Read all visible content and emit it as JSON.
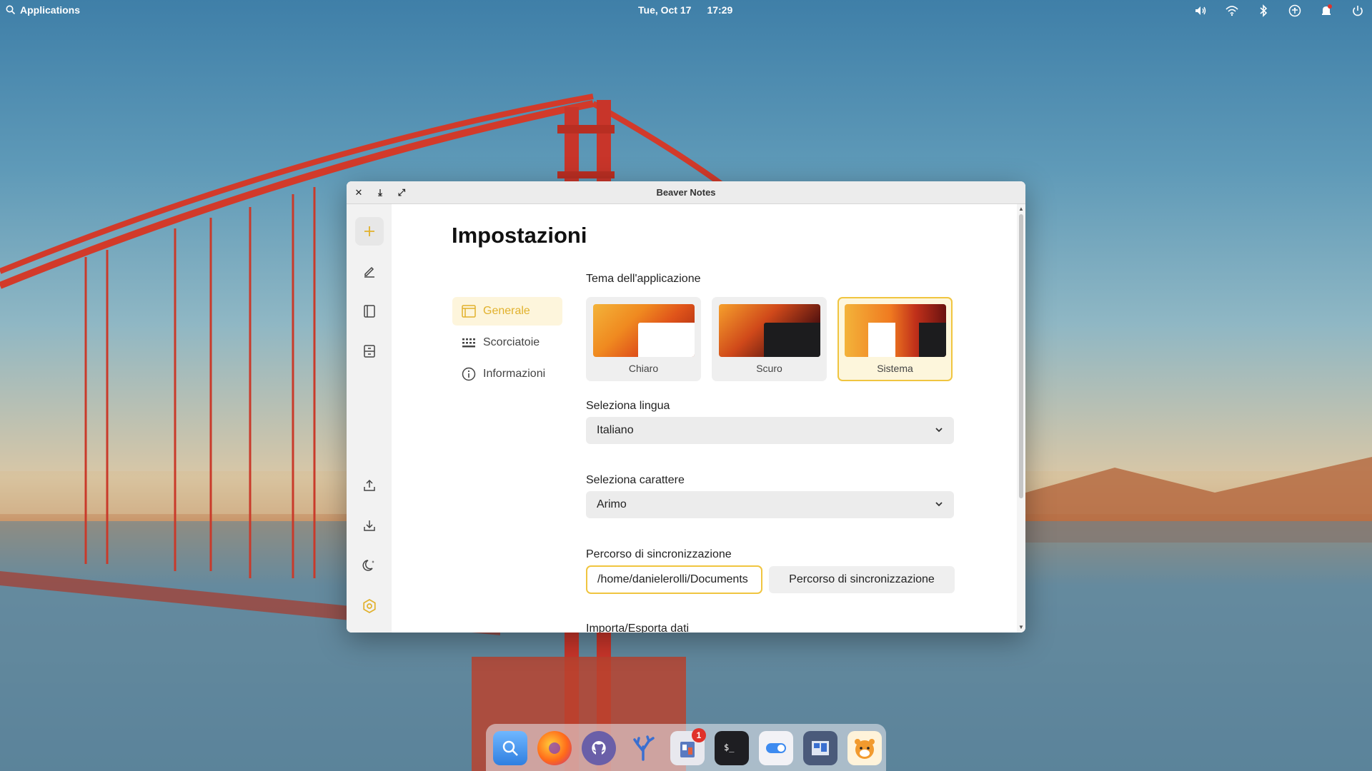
{
  "topbar": {
    "applications_label": "Applications",
    "date": "Tue, Oct 17",
    "time": "17:29",
    "tray_icons": [
      "volume-icon",
      "wifi-icon",
      "bluetooth-icon",
      "accessibility-icon",
      "notification-icon",
      "power-icon"
    ]
  },
  "window": {
    "title": "Beaver Notes",
    "controls": [
      "close-icon",
      "minimize-icon",
      "maximize-icon"
    ]
  },
  "rail": {
    "items": [
      "add-icon",
      "edit-icon",
      "notebook-icon",
      "archive-icon",
      "export-icon",
      "import-icon",
      "dark-mode-icon",
      "settings-icon"
    ]
  },
  "settings": {
    "title": "Impostazioni",
    "menu": [
      {
        "label": "Generale",
        "icon": "window-icon",
        "active": true
      },
      {
        "label": "Scorciatoie",
        "icon": "keyboard-icon",
        "active": false
      },
      {
        "label": "Informazioni",
        "icon": "info-icon",
        "active": false
      }
    ],
    "theme_section": {
      "label": "Tema dell'applicazione",
      "options": [
        {
          "label": "Chiaro",
          "selected": false
        },
        {
          "label": "Scuro",
          "selected": false
        },
        {
          "label": "Sistema",
          "selected": true
        }
      ]
    },
    "language": {
      "label": "Seleziona lingua",
      "value": "Italiano"
    },
    "font": {
      "label": "Seleziona carattere",
      "value": "Arimo"
    },
    "sync": {
      "label": "Percorso di sincronizzazione",
      "path_value": "/home/danielerolli/Documents",
      "button_label": "Percorso di sincronizzazione"
    },
    "next_section_label": "Importa/Esporta dati"
  },
  "dock": {
    "apps": [
      "finder-icon",
      "firefox-icon",
      "github-icon",
      "coral-icon",
      "clipboard-icon",
      "terminal-icon",
      "toggle-icon",
      "workspaces-icon",
      "beaver-icon"
    ],
    "badge_count": "1"
  },
  "colors": {
    "accent": "#f0c540",
    "accent_text": "#e1b12c"
  }
}
